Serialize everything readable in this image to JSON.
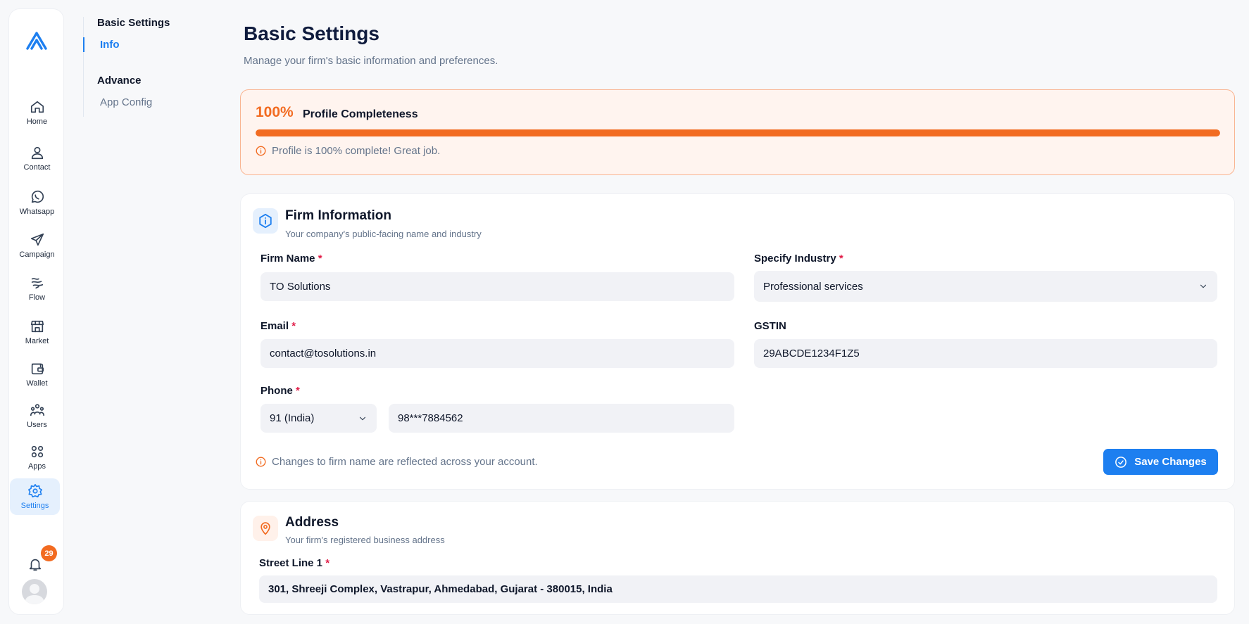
{
  "rail": {
    "items": [
      {
        "label": "Home",
        "icon": "home-icon"
      },
      {
        "label": "Contact",
        "icon": "user-icon"
      },
      {
        "label": "Whatsapp",
        "icon": "whatsapp-icon"
      },
      {
        "label": "Campaign",
        "icon": "send-icon"
      },
      {
        "label": "Flow",
        "icon": "flow-icon"
      },
      {
        "label": "Market",
        "icon": "store-icon"
      },
      {
        "label": "Wallet",
        "icon": "wallet-icon"
      },
      {
        "label": "Users",
        "icon": "users-icon"
      },
      {
        "label": "Apps",
        "icon": "apps-icon"
      },
      {
        "label": "Settings",
        "icon": "settings-icon"
      }
    ],
    "active": "Settings",
    "notification_count": "29"
  },
  "subnav": {
    "groups": [
      {
        "title": "Basic Settings",
        "items": [
          {
            "label": "Info",
            "active": true
          }
        ]
      },
      {
        "title": "Advance",
        "items": [
          {
            "label": "App Config",
            "active": false
          }
        ]
      }
    ]
  },
  "header": {
    "title": "Basic Settings",
    "subtitle": "Manage your firm's basic information and preferences."
  },
  "profile": {
    "percent_label": "100%",
    "title": "Profile Completeness",
    "progress": 1.0,
    "note": "Profile is 100% complete! Great job."
  },
  "firm": {
    "title": "Firm Information",
    "subtitle": "Your company's public-facing name and industry",
    "firm_name_label": "Firm Name",
    "firm_name_value": "TO Solutions",
    "industry_label": "Specify Industry",
    "industry_value": "Professional services",
    "email_label": "Email",
    "email_value": "contact@tosolutions.in",
    "gstin_label": "GSTIN",
    "gstin_value": "29ABCDE1234F1Z5",
    "phone_label": "Phone",
    "phone_code": "91 (India)",
    "phone_value": "98***7884562",
    "hint": "Changes to firm name are reflected across your account.",
    "save_label": "Save Changes",
    "required_mark": "*"
  },
  "address": {
    "title": "Address",
    "subtitle": "Your firm's registered business address",
    "street1_label": "Street Line 1",
    "street1_value": "301, Shreeji Complex, Vastrapur, Ahmedabad, Gujarat - 380015, India"
  },
  "colors": {
    "accent": "#1d7ff0",
    "orange": "#f26b21",
    "required": "#e11d48"
  }
}
